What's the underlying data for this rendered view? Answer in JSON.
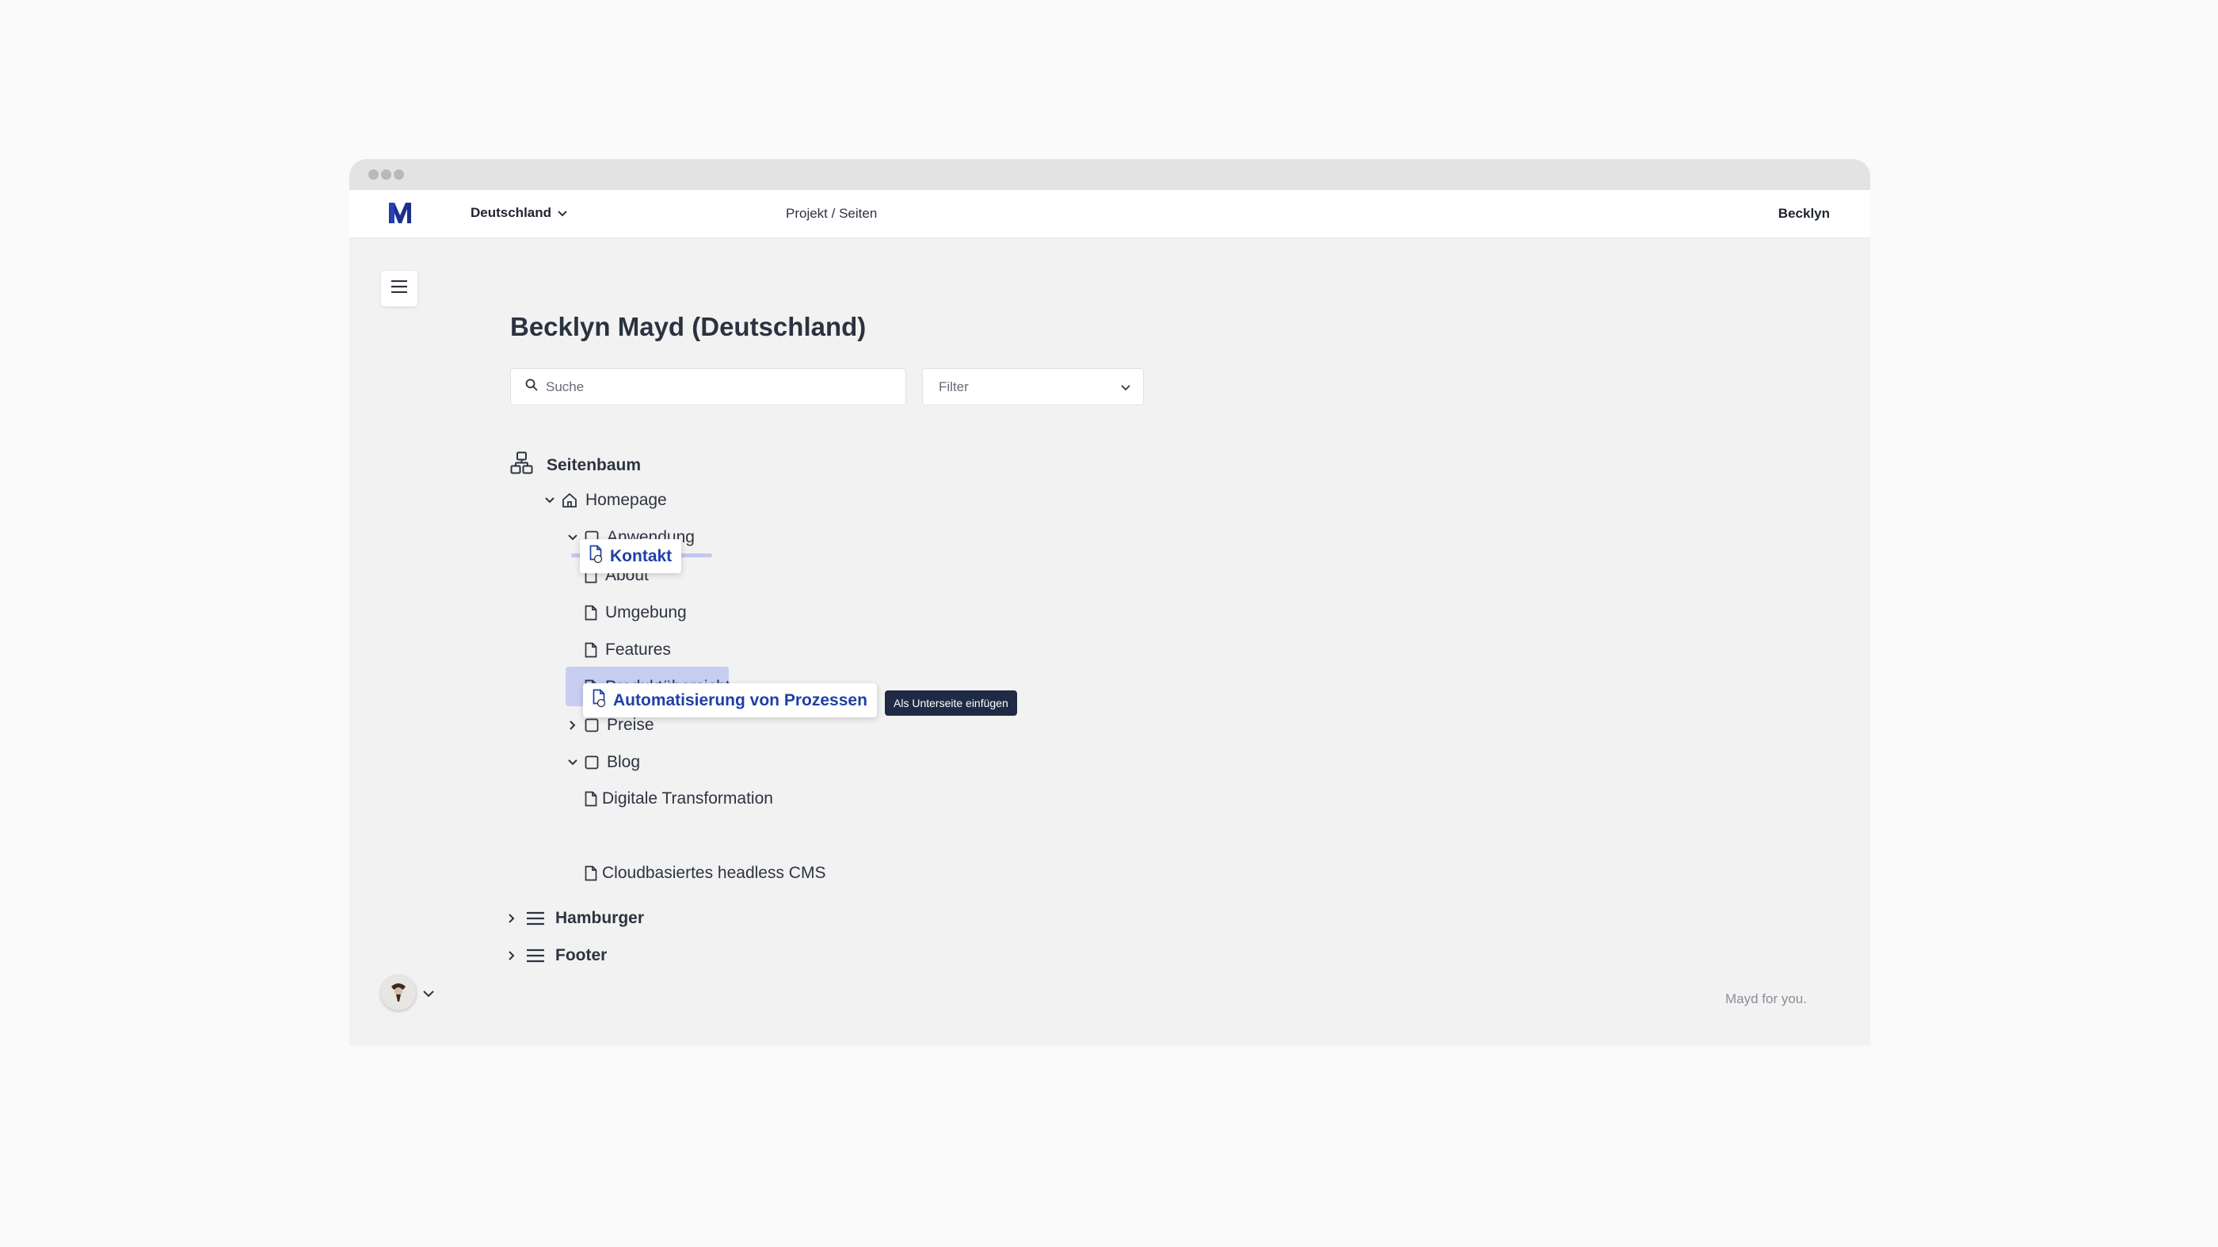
{
  "colors": {
    "accent": "#1f3fa8",
    "highlight": "#c8cdf2",
    "tooltip_bg": "#1f2a44",
    "background": "#f2f2f2"
  },
  "header": {
    "country": "Deutschland",
    "breadcrumb": "Projekt / Seiten",
    "user": "Becklyn"
  },
  "page": {
    "title": "Becklyn Mayd (Deutschland)"
  },
  "search": {
    "placeholder": "Suche"
  },
  "filter": {
    "label": "Filter"
  },
  "tree": {
    "root_label": "Seitenbaum",
    "items": [
      {
        "label": "Homepage",
        "icon": "home-icon"
      },
      {
        "label": "Anwendung",
        "icon": "folder-icon"
      },
      {
        "label": "About",
        "icon": "page-icon"
      },
      {
        "label": "Umgebung",
        "icon": "page-icon"
      },
      {
        "label": "Features",
        "icon": "page-icon"
      },
      {
        "label": "Produktübersicht",
        "icon": "page-icon"
      },
      {
        "label": "Preise",
        "icon": "folder-icon"
      },
      {
        "label": "Blog",
        "icon": "folder-icon"
      },
      {
        "label": "Digitale Transformation",
        "icon": "page-icon"
      },
      {
        "label": "Cloudbasiertes headless CMS",
        "icon": "page-icon"
      }
    ],
    "sections": [
      {
        "label": "Hamburger",
        "icon": "menu-icon"
      },
      {
        "label": "Footer",
        "icon": "menu-icon"
      }
    ]
  },
  "drag": {
    "chip_1": "Kontakt",
    "chip_2": "Automatisierung von Prozessen",
    "tooltip": "Als Unterseite einfügen"
  },
  "footer": {
    "tagline": "Mayd for you."
  }
}
